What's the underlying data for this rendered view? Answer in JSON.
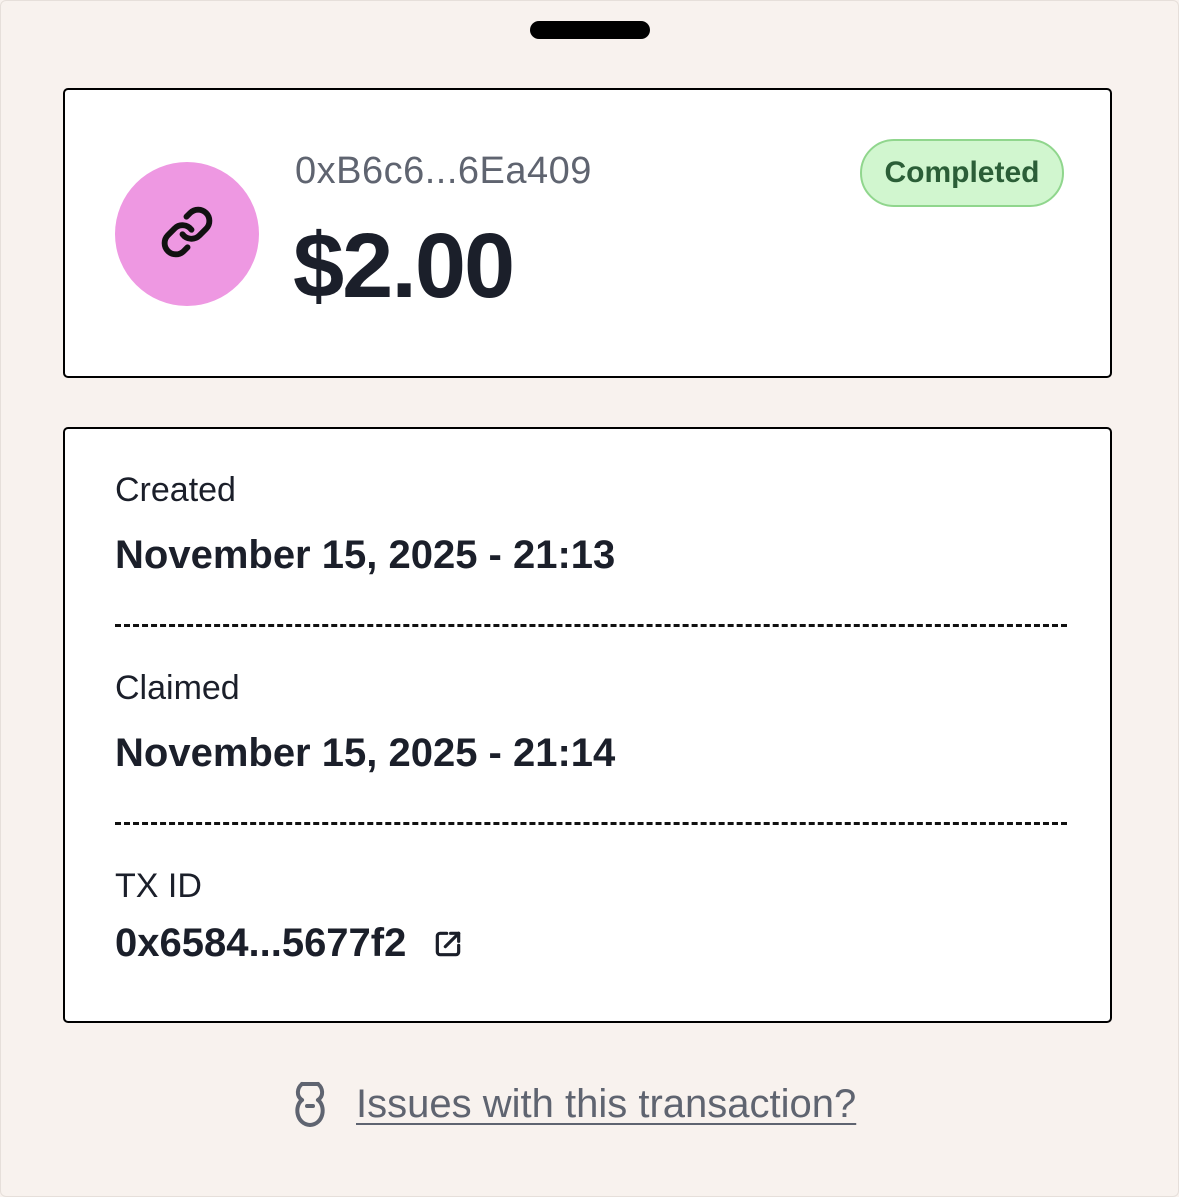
{
  "summary": {
    "address": "0xB6c6...6Ea409",
    "amount": "$2.00",
    "status": "Completed",
    "avatar_icon": "link-icon",
    "avatar_color": "#ee98e2",
    "status_bg_color": "#d1f6cf",
    "status_text_color": "#2b5e37"
  },
  "details": {
    "created_label": "Created",
    "created_value": "November 15, 2025 - 21:13",
    "claimed_label": "Claimed",
    "claimed_value": "November 15, 2025 - 21:14",
    "txid_label": "TX ID",
    "txid_value": "0x6584...5677f2",
    "txid_icon": "external-link-icon"
  },
  "footer": {
    "issues_label": "Issues with this transaction?",
    "issues_icon": "support-icon"
  }
}
